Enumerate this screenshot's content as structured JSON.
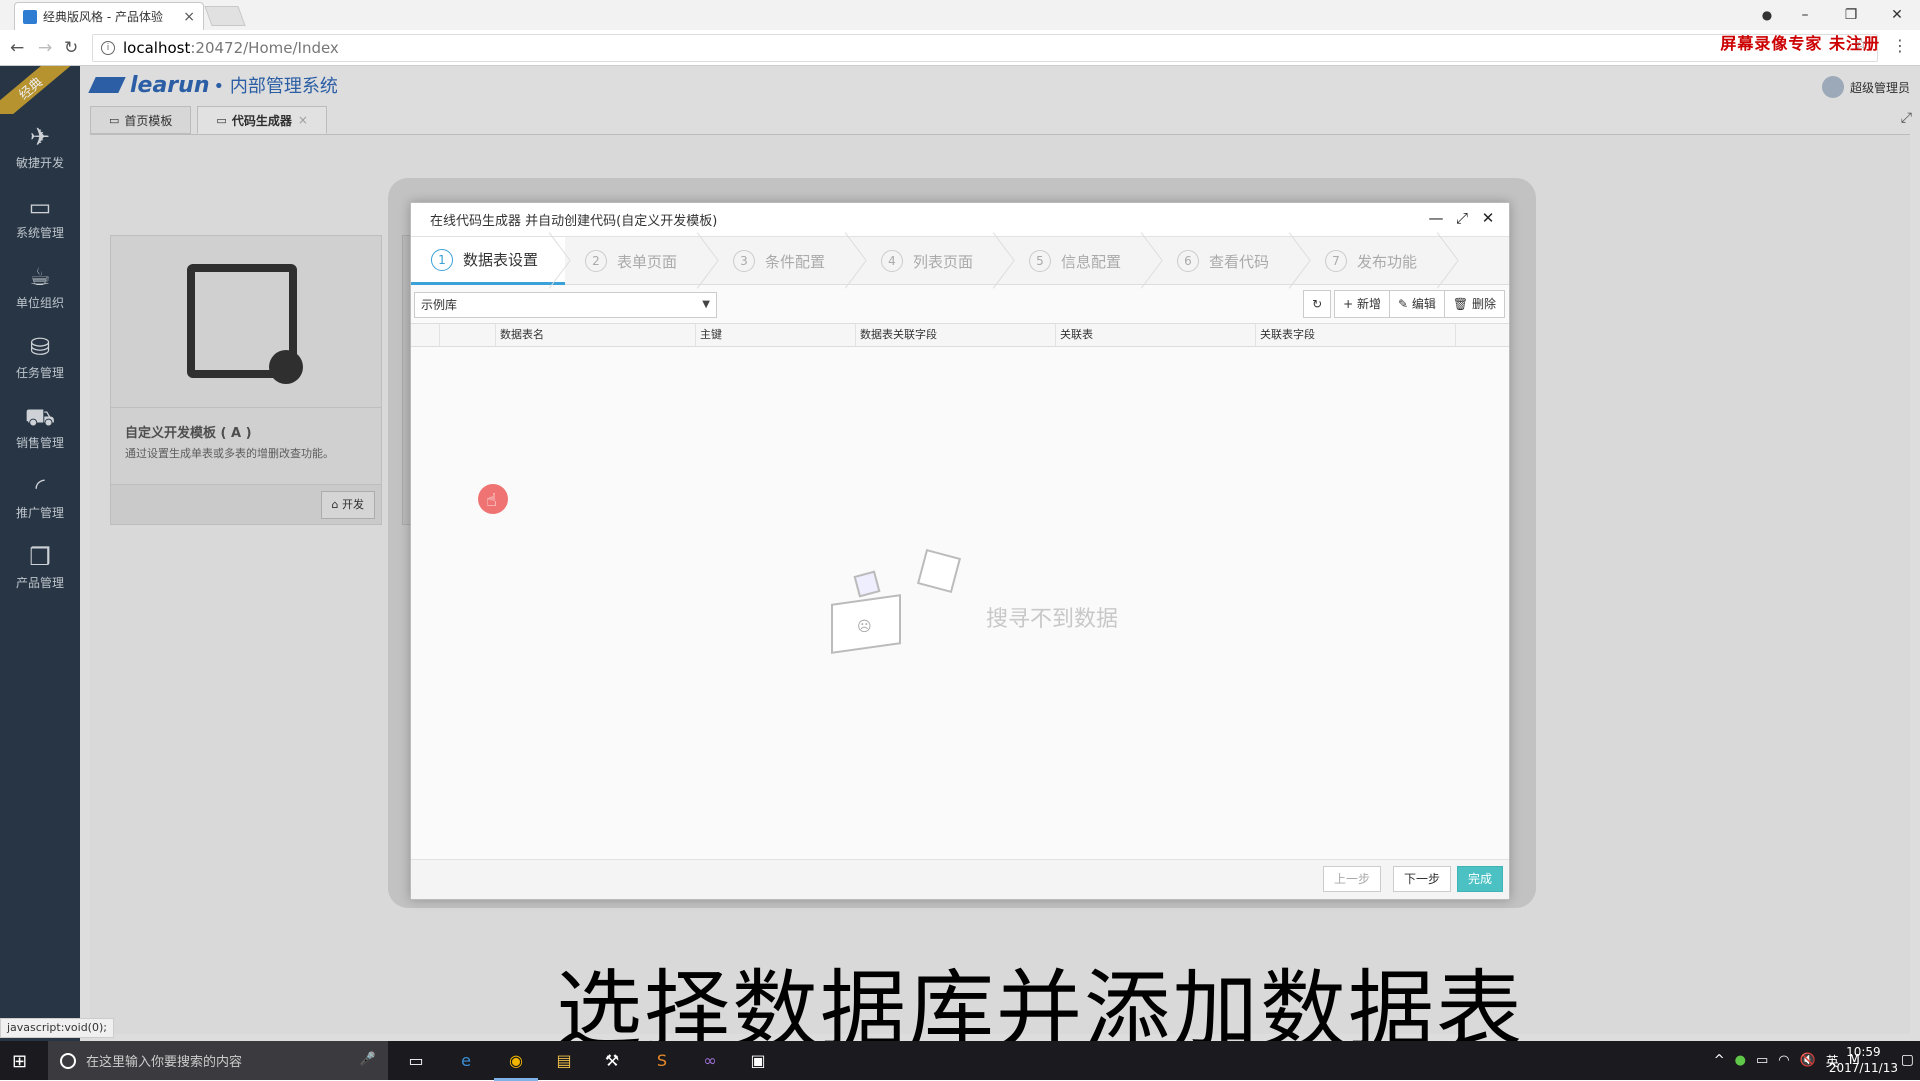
{
  "browser": {
    "tab_title": "经典版风格 - 产品体验",
    "tab_close": "×",
    "url_host": "localhost",
    "url_path": ":20472/Home/Index",
    "watermark": "屏幕录像专家  未注册"
  },
  "app": {
    "logo_brand": "learun",
    "logo_system": "• 内部管理系统",
    "user_name": "超级管理员",
    "ribbon": "经典",
    "sidebar": [
      {
        "label": "敏捷开发",
        "icon": "paper-plane-icon"
      },
      {
        "label": "系统管理",
        "icon": "monitor-icon"
      },
      {
        "label": "单位组织",
        "icon": "coffee-icon"
      },
      {
        "label": "任务管理",
        "icon": "inbox-icon"
      },
      {
        "label": "销售管理",
        "icon": "car-icon"
      },
      {
        "label": "推广管理",
        "icon": "rss-icon"
      },
      {
        "label": "产品管理",
        "icon": "cubes-icon"
      }
    ],
    "tabs": [
      {
        "label": "首页模板"
      },
      {
        "label": "代码生成器",
        "close": "×"
      }
    ]
  },
  "card": {
    "title": "自定义开发模板 ( A )",
    "desc": "通过设置生成单表或多表的增删改查功能。",
    "button": "开发"
  },
  "dialog": {
    "title": "在线代码生成器 并自动创建代码(自定义开发模板)",
    "steps": [
      {
        "num": "1",
        "label": "数据表设置"
      },
      {
        "num": "2",
        "label": "表单页面"
      },
      {
        "num": "3",
        "label": "条件配置"
      },
      {
        "num": "4",
        "label": "列表页面"
      },
      {
        "num": "5",
        "label": "信息配置"
      },
      {
        "num": "6",
        "label": "查看代码"
      },
      {
        "num": "7",
        "label": "发布功能"
      }
    ],
    "db_select": "示例库",
    "toolbar": {
      "add": "新增",
      "edit": "编辑",
      "delete": "删除"
    },
    "columns": [
      "数据表名",
      "主键",
      "数据表关联字段",
      "关联表",
      "关联表字段"
    ],
    "empty_text": "搜寻不到数据",
    "footer": {
      "prev": "上一步",
      "next": "下一步",
      "done": "完成"
    }
  },
  "caption": "选择数据库并添加数据表",
  "status_text": "javascript:void(0);",
  "taskbar": {
    "search_placeholder": "在这里输入你要搜索的内容",
    "ime": "英",
    "time": "10:59",
    "date": "2017/11/13"
  }
}
